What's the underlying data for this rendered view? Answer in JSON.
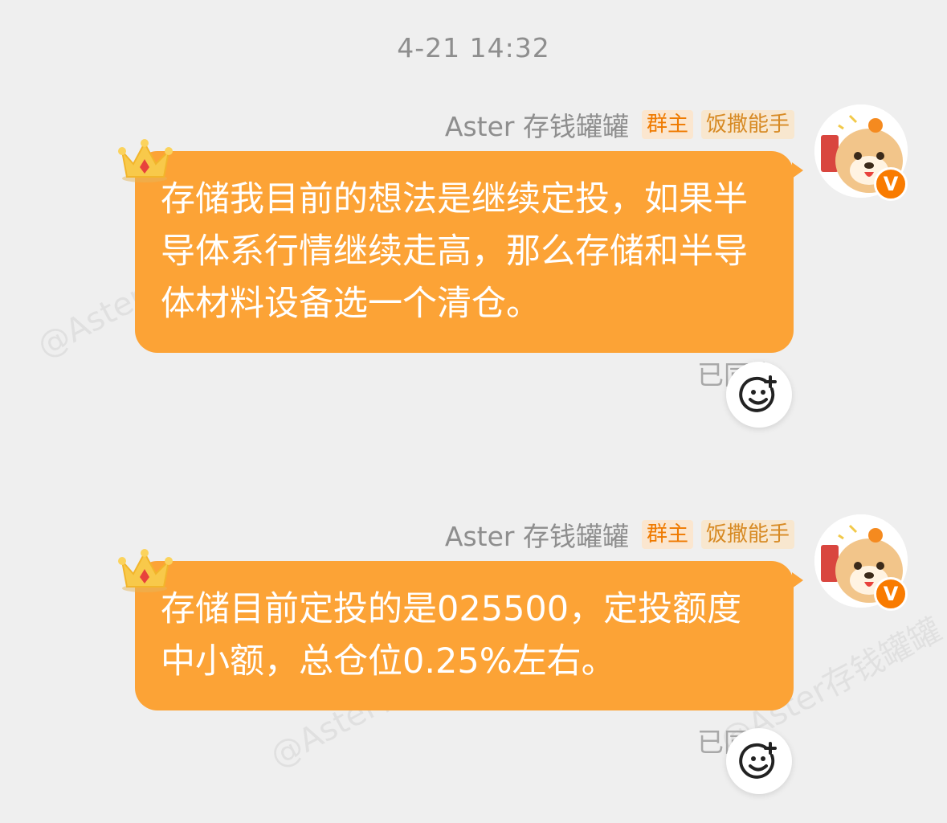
{
  "chat": {
    "timestamp": "4-21 14:32",
    "watermark": "@Aster存钱罐罐",
    "messages": [
      {
        "sender": "Aster 存钱罐罐",
        "badges": [
          "群主",
          "饭撒能手"
        ],
        "text": "存储我目前的想法是继续定投，如果半导体系行情继续走高，那么存储和半导体材料设备选一个清仓。",
        "status": "已同步"
      },
      {
        "sender": "Aster 存钱罐罐",
        "badges": [
          "群主",
          "饭撒能手"
        ],
        "text": "存储目前定投的是025500，定投额度中小额，总仓位0.25%左右。",
        "status": "已同步"
      }
    ]
  },
  "colors": {
    "bubble": "#fca336",
    "background": "#efefef",
    "owner_badge_text": "#ef7a00",
    "verified_badge": "#f97b00"
  },
  "icons": [
    "crown-icon",
    "add-reaction-icon",
    "verified-icon"
  ]
}
